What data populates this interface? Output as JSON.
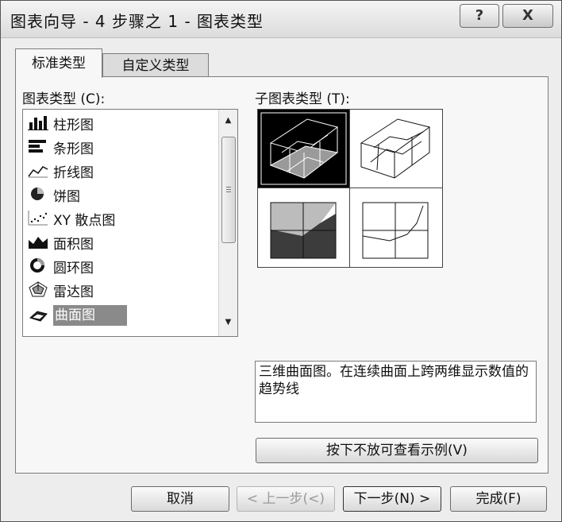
{
  "window": {
    "title": "图表向导 - 4 步骤之 1 - 图表类型"
  },
  "titlebar": {
    "help_label": "?",
    "close_label": "X"
  },
  "tabs": [
    {
      "label": "标准类型",
      "active": true
    },
    {
      "label": "自定义类型",
      "active": false
    }
  ],
  "chart_type_list": {
    "label": "图表类型 (C):",
    "items": [
      {
        "label": "柱形图",
        "icon": "column-chart-icon"
      },
      {
        "label": "条形图",
        "icon": "bar-chart-icon"
      },
      {
        "label": "折线图",
        "icon": "line-chart-icon"
      },
      {
        "label": "饼图",
        "icon": "pie-chart-icon"
      },
      {
        "label": "XY 散点图",
        "icon": "scatter-chart-icon"
      },
      {
        "label": "面积图",
        "icon": "area-chart-icon"
      },
      {
        "label": "圆环图",
        "icon": "doughnut-chart-icon"
      },
      {
        "label": "雷达图",
        "icon": "radar-chart-icon"
      },
      {
        "label": "曲面图",
        "icon": "surface-chart-icon",
        "selected": true
      }
    ],
    "scroll_up": "▲",
    "scroll_down": "▼"
  },
  "subtype": {
    "label": "子图表类型 (T):"
  },
  "description": "三维曲面图。在连续曲面上跨两维显示数值的趋势线",
  "preview_button": "按下不放可查看示例(V)",
  "footer": {
    "cancel": "取消",
    "back": "< 上一步(<)",
    "next": "下一步(N) >",
    "finish": "完成(F)"
  },
  "colors": {
    "selection": "#8a8a8a",
    "dialog_bg": "#ededed"
  }
}
